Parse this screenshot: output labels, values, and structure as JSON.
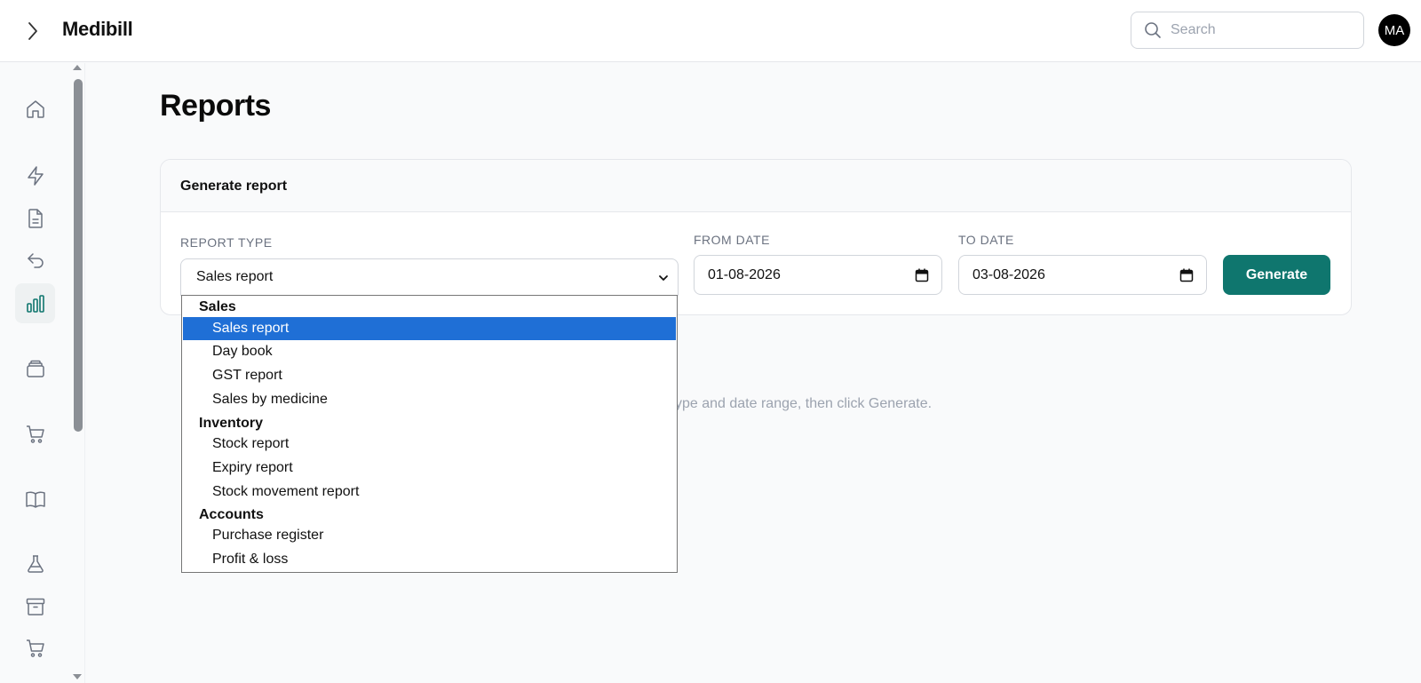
{
  "header": {
    "brand": "Medibill",
    "search_placeholder": "Search",
    "avatar_initials": "MA",
    "expand_icon": "chevron-right-icon"
  },
  "sidebar": {
    "items": [
      {
        "name": "home",
        "icon": "home-icon",
        "active": false
      },
      {
        "name": "quick",
        "icon": "lightning-icon",
        "active": false
      },
      {
        "name": "invoices",
        "icon": "document-icon",
        "active": false
      },
      {
        "name": "returns",
        "icon": "undo-arrow-icon",
        "active": false
      },
      {
        "name": "reports",
        "icon": "bar-chart-icon",
        "active": true
      },
      {
        "name": "inventory",
        "icon": "layers-box-icon",
        "active": false
      },
      {
        "name": "purchases",
        "icon": "cart-icon",
        "active": false
      },
      {
        "name": "catalog",
        "icon": "book-icon",
        "active": false
      },
      {
        "name": "lab",
        "icon": "flask-icon",
        "active": false
      },
      {
        "name": "archive",
        "icon": "archive-icon",
        "active": false
      },
      {
        "name": "orders",
        "icon": "cart-icon",
        "active": false
      }
    ]
  },
  "main": {
    "title": "Reports",
    "card": {
      "heading": "Generate report",
      "report_type_label": "REPORT TYPE",
      "report_type_value": "Sales report",
      "from_label": "FROM DATE",
      "from_value": "01-08-2026",
      "to_label": "TO DATE",
      "to_value": "03-08-2026",
      "generate_label": "Generate"
    },
    "empty_hint": "ype and date range, then click Generate."
  },
  "dropdown": {
    "groups": [
      {
        "label": "Sales",
        "options": [
          "Sales report",
          "Day book",
          "GST report",
          "Sales by medicine"
        ]
      },
      {
        "label": "Inventory",
        "options": [
          "Stock report",
          "Expiry report",
          "Stock movement report"
        ]
      },
      {
        "label": "Accounts",
        "options": [
          "Purchase register",
          "Profit & loss"
        ]
      }
    ],
    "selected": "Sales report"
  },
  "colors": {
    "accent": "#0f766e",
    "selected_option": "#1f6fd6",
    "active_nav_icon": "#0f766e"
  }
}
